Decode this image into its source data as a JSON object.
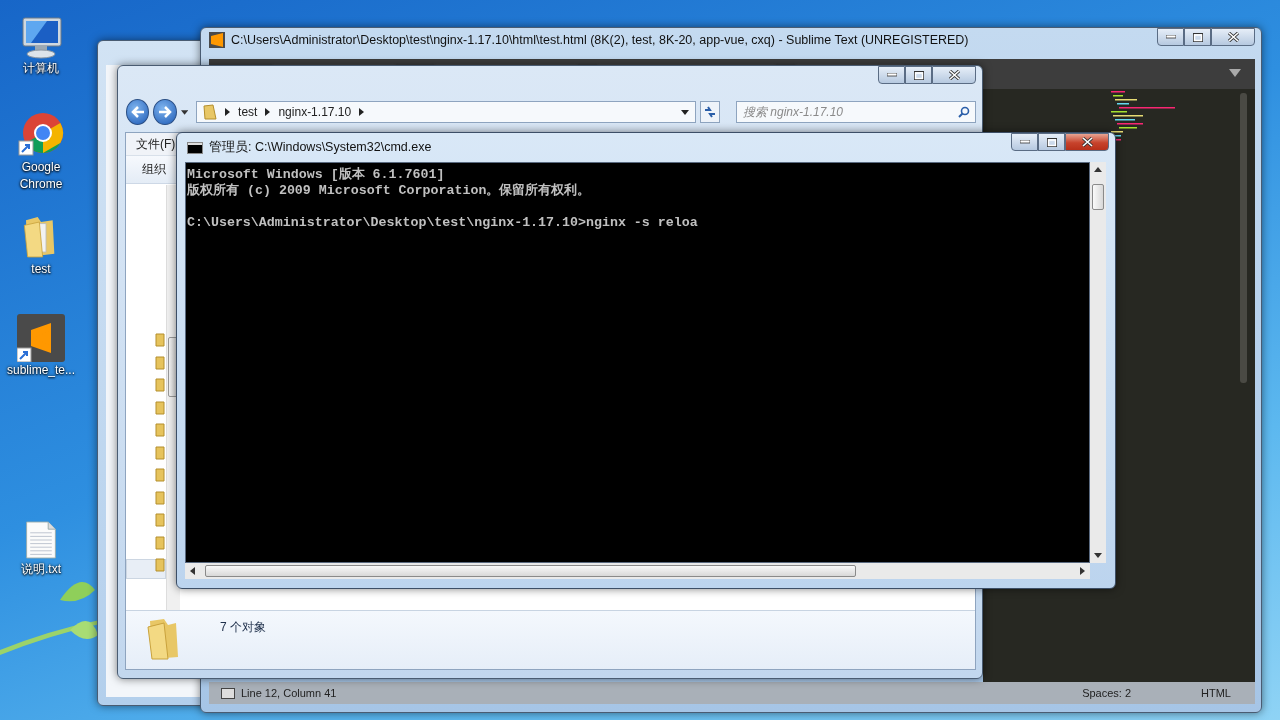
{
  "desktop_icons": [
    {
      "label": "计算机",
      "kind": "computer"
    },
    {
      "label": "Google Chrome",
      "kind": "chrome"
    },
    {
      "label": "test",
      "kind": "folder"
    },
    {
      "label": "sublime_te...",
      "kind": "sublime"
    },
    {
      "label": "说明.txt",
      "kind": "textfile"
    }
  ],
  "editor": {
    "title": "C:\\Users\\Administrator\\Desktop\\test\\nginx-1.17.10\\html\\test.html (8K(2), test, 8K-20, app-vue, cxq) - Sublime Text (UNREGISTERED)",
    "status_bar": {
      "position": "Line 12, Column 41",
      "indentation": "Spaces: 2",
      "syntax": "HTML"
    }
  },
  "explorer": {
    "breadcrumb": [
      "test",
      "nginx-1.17.10"
    ],
    "search": {
      "placeholder": "搜索 nginx-1.17.10"
    },
    "menu": [
      "文件(F)"
    ],
    "toolbar": [
      "组织"
    ],
    "status": "7 个对象"
  },
  "console": {
    "title": "管理员: C:\\Windows\\System32\\cmd.exe",
    "banner": [
      "Microsoft Windows [版本 6.1.7601]",
      "版权所有 (c) 2009 Microsoft Corporation。保留所有权利。"
    ],
    "prompt": "C:\\Users\\Administrator\\Desktop\\test\\nginx-1.17.10>nginx -s reloa"
  }
}
